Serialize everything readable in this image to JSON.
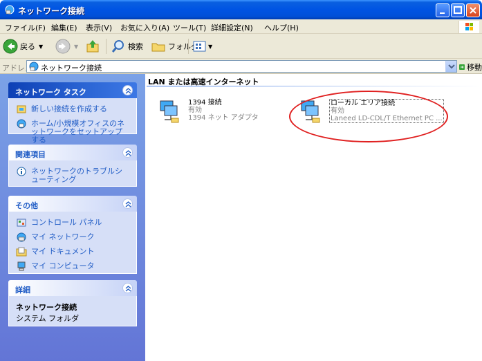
{
  "window": {
    "title": "ネットワーク接続",
    "colors": {
      "titlebar": "#0054e3",
      "close": "#d7431c"
    }
  },
  "menu": [
    "ファイル(F)",
    "編集(E)",
    "表示(V)",
    "お気に入り(A)",
    "ツール(T)",
    "詳細設定(N)",
    "ヘルプ(H)"
  ],
  "toolbar": {
    "back": "戻る",
    "search": "検索",
    "folders": "フォルダ"
  },
  "address": {
    "label": "アドレス(D)",
    "value": "ネットワーク接続",
    "go": "移動"
  },
  "sidebar": {
    "tasks": {
      "title": "ネットワーク タスク",
      "items": [
        "新しい接続を作成する",
        "ホーム/小規模オフィスのネットワークをセットアップする"
      ]
    },
    "related": {
      "title": "関連項目",
      "items": [
        "ネットワークのトラブルシューティング"
      ]
    },
    "other": {
      "title": "その他",
      "items": [
        "コントロール パネル",
        "マイ ネットワーク",
        "マイ ドキュメント",
        "マイ コンピュータ"
      ]
    },
    "details": {
      "title": "詳細",
      "name": "ネットワーク接続",
      "type": "システム フォルダ"
    }
  },
  "content": {
    "group_title": "LAN または高速インターネット",
    "connections": [
      {
        "name": "1394 接続",
        "status": "有効",
        "device": "1394 ネット アダプタ"
      },
      {
        "name": "ローカル エリア接続",
        "status": "有効",
        "device": "Laneed LD-CDL/T Ethernet PC ..."
      }
    ],
    "highlight_color": "#e02020"
  }
}
